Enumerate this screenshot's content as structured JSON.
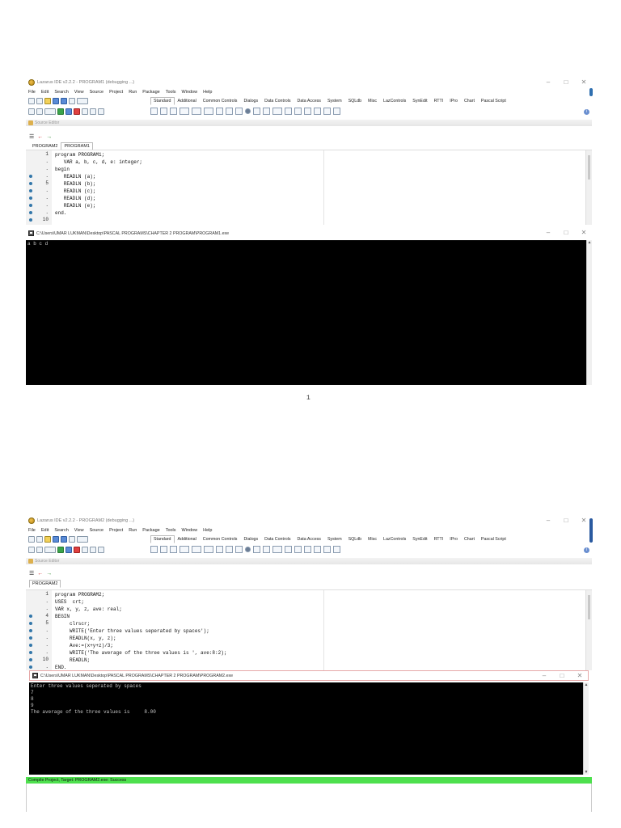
{
  "page": {
    "page_number": "1"
  },
  "shot1": {
    "window_title": "Lazarus IDE v2.2.2 - PROGRAM1 (debugging ...)",
    "menu": [
      "File",
      "Edit",
      "Search",
      "View",
      "Source",
      "Project",
      "Run",
      "Package",
      "Tools",
      "Window",
      "Help"
    ],
    "palette_tabs": [
      "Standard",
      "Additional",
      "Common Controls",
      "Dialogs",
      "Data Controls",
      "Data Access",
      "System",
      "SQLdb",
      "Misc",
      "LazControls",
      "SynEdit",
      "RTTI",
      "IPro",
      "Chart",
      "Pascal Script"
    ],
    "active_palette_tab": "Standard",
    "source_editor_label": "Source Editor",
    "file_tabs": [
      "PROGRAM2",
      "PROGRAM1"
    ],
    "active_file_tab": "PROGRAM1",
    "gutter": [
      "1",
      ".",
      ".",
      ".",
      "5",
      ".",
      ".",
      ".",
      ".",
      "10"
    ],
    "code_lines": [
      "program PROGRAM1;",
      "   VAR a, b, c, d, e: integer;",
      "begin",
      "   READLN (a);",
      "   READLN (b);",
      "   READLN (c);",
      "   READLN (d);",
      "   READLN (e);",
      "end.",
      ""
    ],
    "console_title": "C:\\Users\\UMAR LUKMAN\\Desktop\\PASCAL PROGRAMS\\CHAPTER 2 PROGRAM\\PROGRAM1.exe",
    "console_output": "a b c d"
  },
  "shot2": {
    "window_title": "Lazarus IDE v2.2.2 - PROGRAM2 (debugging ...)",
    "menu": [
      "File",
      "Edit",
      "Search",
      "View",
      "Source",
      "Project",
      "Run",
      "Package",
      "Tools",
      "Window",
      "Help"
    ],
    "palette_tabs": [
      "Standard",
      "Additional",
      "Common Controls",
      "Dialogs",
      "Data Controls",
      "Data Access",
      "System",
      "SQLdb",
      "Misc",
      "LazControls",
      "SynEdit",
      "RTTI",
      "IPro",
      "Chart",
      "Pascal Script"
    ],
    "active_palette_tab": "Standard",
    "source_editor_label": "Source Editor",
    "file_tabs": [
      "PROGRAM2"
    ],
    "active_file_tab": "PROGRAM2",
    "gutter": [
      "1",
      ".",
      ".",
      "4",
      "5",
      ".",
      ".",
      ".",
      ".",
      "10",
      "."
    ],
    "code_lines": [
      "program PROGRAM2;",
      "USES  crt;",
      "VAR x, y, z, ave: real;",
      "BEGIN",
      "     clrscr;",
      "     WRITE('Enter three values seperated by spaces');",
      "     READLN(x, y, z);",
      "     Ave:=(x+y+z)/3;",
      "     WRITE('The average of the three values is ', ave:8:2);",
      "     READLN;",
      "END."
    ],
    "console_title": "C:\\Users\\UMAR LUKMAN\\Desktop\\PASCAL PROGRAMS\\CHAPTER 2 PROGRAM\\PROGRAM2.exe",
    "console_output": "Enter three values seperated by spaces\n7\n8\n9\nThe average of the three values is     8.00",
    "status_message": "Compile Project, Target: PROGRAM2.exe: Success"
  },
  "window_controls": {
    "minimize": "–",
    "maximize": "□",
    "close": "✕"
  },
  "icons": {
    "info": "i",
    "scroll_up": "▲",
    "scroll_down": "▼",
    "nav_back": "←",
    "nav_forward": "→"
  },
  "colors": {
    "console_bg": "#000000",
    "status_success": "#4ee04e",
    "string_literal": "#1c3ab8",
    "symbol": "#c82020"
  }
}
